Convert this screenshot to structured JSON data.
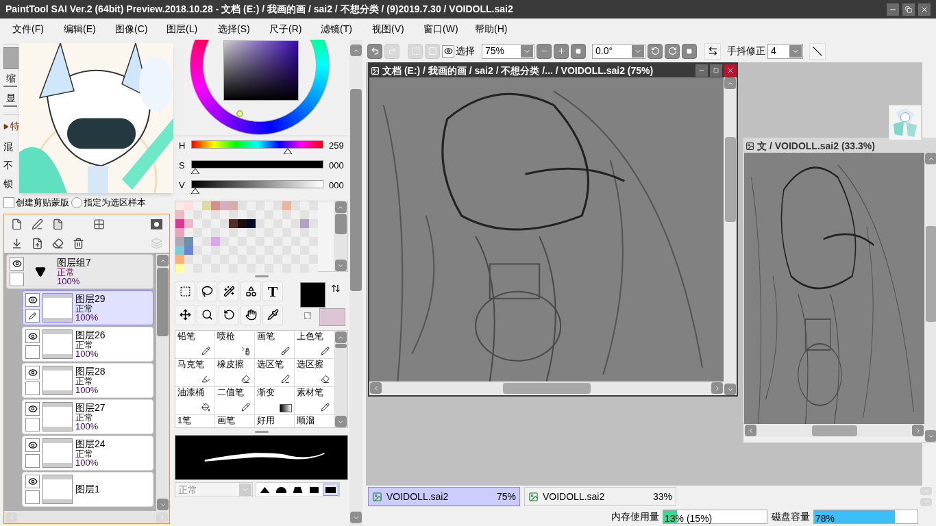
{
  "window": {
    "title": "PaintTool SAI Ver.2 (64bit) Preview.2018.10.28 - 文档 (E:) / 我画的画 / sai2 / 不想分类 / (9)2019.7.30 / VOIDOLL.sai2"
  },
  "menu": [
    "文件(F)",
    "编辑(E)",
    "图像(C)",
    "图层(L)",
    "选择(S)",
    "尺子(R)",
    "滤镜(T)",
    "视图(V)",
    "窗口(W)",
    "帮助(H)"
  ],
  "properties": [
    {
      "label": "缩",
      "kind": "slider"
    },
    {
      "label": "显",
      "kind": "slider"
    },
    {
      "label": "特",
      "kind": "section",
      "expanded": false
    },
    {
      "label": "混",
      "kind": "field"
    },
    {
      "label": "不",
      "kind": "field"
    },
    {
      "label": "锁",
      "kind": "field"
    }
  ],
  "layer_options": [
    {
      "label": "创建剪贴蒙版",
      "kind": "checkbox",
      "checked": false
    },
    {
      "label": "指定为选区样本",
      "kind": "radio",
      "checked": false
    }
  ],
  "layers": [
    {
      "name": "图层组7",
      "mode": "正常",
      "opacity": "100%",
      "kind": "group",
      "visible": true,
      "selected": false,
      "expanded": true,
      "children": [
        {
          "name": "图层29",
          "mode": "正常",
          "opacity": "100%",
          "kind": "layer",
          "visible": true,
          "selected": true
        },
        {
          "name": "图层26",
          "mode": "正常",
          "opacity": "100%",
          "kind": "layer",
          "visible": true,
          "selected": false
        },
        {
          "name": "图层28",
          "mode": "正常",
          "opacity": "100%",
          "kind": "layer",
          "visible": true,
          "selected": false
        },
        {
          "name": "图层27",
          "mode": "正常",
          "opacity": "100%",
          "kind": "layer",
          "visible": true,
          "selected": false
        },
        {
          "name": "图层24",
          "mode": "正常",
          "opacity": "100%",
          "kind": "layer",
          "visible": true,
          "selected": false
        },
        {
          "name": "图层1",
          "kind": "layer",
          "visible": true,
          "selected": false
        }
      ]
    }
  ],
  "color": {
    "sliders": [
      {
        "label": "H",
        "value": "259",
        "level": 0.72,
        "kind": "hue"
      },
      {
        "label": "S",
        "value": "000",
        "level": 0,
        "kind": "saturation"
      },
      {
        "label": "V",
        "value": "000",
        "level": 0,
        "kind": "value"
      }
    ],
    "foreground": {
      "color": "#000000"
    },
    "background": {
      "color": "#dcc4d4"
    }
  },
  "swatches": [
    [
      {
        "kind": "swatch",
        "color": "#fde8e2"
      },
      {
        "kind": "swatch",
        "color": "#fbdfe2"
      },
      {
        "kind": "empty"
      },
      {
        "kind": "swatch",
        "color": "#dcd9a2"
      },
      {
        "kind": "swatch",
        "color": "#d4918c"
      },
      {
        "kind": "swatch",
        "color": "#d4afc0"
      },
      {
        "kind": "swatch",
        "color": "#d4afa8"
      },
      {
        "kind": "empty"
      },
      {
        "kind": "empty"
      },
      {
        "kind": "empty"
      },
      {
        "kind": "empty"
      },
      {
        "kind": "empty"
      },
      {
        "kind": "swatch",
        "color": "#ecb49e"
      }
    ],
    [
      {
        "kind": "swatch",
        "color": "#ebbcc4"
      }
    ],
    [
      {
        "kind": "swatch",
        "color": "#d23e94"
      },
      {
        "kind": "swatch",
        "color": "#ebb8cc"
      },
      {
        "kind": "empty"
      },
      {
        "kind": "empty"
      },
      {
        "kind": "empty"
      },
      {
        "kind": "empty"
      },
      {
        "kind": "swatch",
        "color": "#56301e"
      },
      {
        "kind": "swatch",
        "color": "#1a0f0c"
      },
      {
        "kind": "swatch",
        "color": "#020a24"
      },
      {
        "kind": "empty"
      },
      {
        "kind": "empty"
      },
      {
        "kind": "empty"
      },
      {
        "kind": "empty"
      },
      {
        "kind": "empty"
      },
      {
        "kind": "swatch",
        "color": "#b4a0c0"
      }
    ],
    [
      {
        "kind": "swatch",
        "color": "#e8a4bc"
      }
    ],
    [
      {
        "kind": "swatch",
        "color": "#aea8b4"
      },
      {
        "kind": "swatch",
        "color": "#6a90ac"
      },
      {
        "kind": "empty"
      },
      {
        "kind": "empty"
      },
      {
        "kind": "swatch",
        "color": "#dca4ec"
      }
    ],
    [
      {
        "kind": "swatch",
        "color": "#78cddc"
      },
      {
        "kind": "swatch",
        "color": "#6a86d2"
      }
    ],
    [
      {
        "kind": "swatch",
        "color": "#ffae80"
      }
    ],
    [
      {
        "kind": "swatch",
        "color": "#ffff9c"
      }
    ]
  ],
  "tools": [
    {
      "kind": "rect-select"
    },
    {
      "kind": "lasso"
    },
    {
      "kind": "magic-wand"
    },
    {
      "kind": "shape"
    },
    {
      "kind": "text",
      "glyph": "T"
    },
    {
      "kind": "move"
    },
    {
      "kind": "zoom"
    },
    {
      "kind": "rotate"
    },
    {
      "kind": "hand"
    },
    {
      "kind": "eyedropper"
    }
  ],
  "brushes": [
    {
      "name": "铅笔",
      "kind": "pencil"
    },
    {
      "name": "喷枪",
      "kind": "airbrush"
    },
    {
      "name": "画笔",
      "kind": "brush"
    },
    {
      "name": "上色笔",
      "kind": "pencil"
    },
    {
      "name": "马克笔",
      "kind": "marker"
    },
    {
      "name": "橡皮擦",
      "kind": "eraser"
    },
    {
      "name": "选区笔",
      "kind": "select-pen"
    },
    {
      "name": "选区擦",
      "kind": "select-eraser"
    },
    {
      "name": "油漆桶",
      "kind": "bucket"
    },
    {
      "name": "二值笔",
      "kind": "binary"
    },
    {
      "name": "渐变",
      "kind": "gradient"
    },
    {
      "name": "素材笔",
      "kind": "pencil"
    },
    {
      "name": "1笔",
      "kind": "none"
    },
    {
      "name": "画笔",
      "kind": "none"
    },
    {
      "name": "好用",
      "kind": "none"
    },
    {
      "name": "顺溜",
      "kind": "none"
    }
  ],
  "brush_mode": {
    "value": "正常",
    "disabled": true
  },
  "brush_shapes": [
    {
      "selected": false
    },
    {
      "selected": false
    },
    {
      "selected": false
    },
    {
      "selected": false
    },
    {
      "selected": true
    }
  ],
  "toolbar": {
    "undo_disabled": false,
    "redo_disabled": true,
    "view_label": "选择",
    "zoom": "75%",
    "angle": "0.0°",
    "stabilizer_label": "手抖修正",
    "stabilizer": "4"
  },
  "documents": [
    {
      "title": "文档 (E:) / 我画的画 / sai2 / 不想分类 /... / VOIDOLL.sai2 (75%)",
      "active": true
    },
    {
      "title": "文 / VOIDOLL.sai2 (33.3%)",
      "active": false
    }
  ],
  "tabs": [
    {
      "name": "VOIDOLL.sai2",
      "zoom": "75%",
      "selected": true
    },
    {
      "name": "VOIDOLL.sai2",
      "zoom": "33%",
      "selected": false
    }
  ],
  "status": {
    "memory": {
      "label": "内存使用量",
      "reading": "13% (15%)",
      "level": 0.13
    },
    "disk": {
      "label": "磁盘容量",
      "reading": "78%",
      "level": 0.78
    }
  }
}
